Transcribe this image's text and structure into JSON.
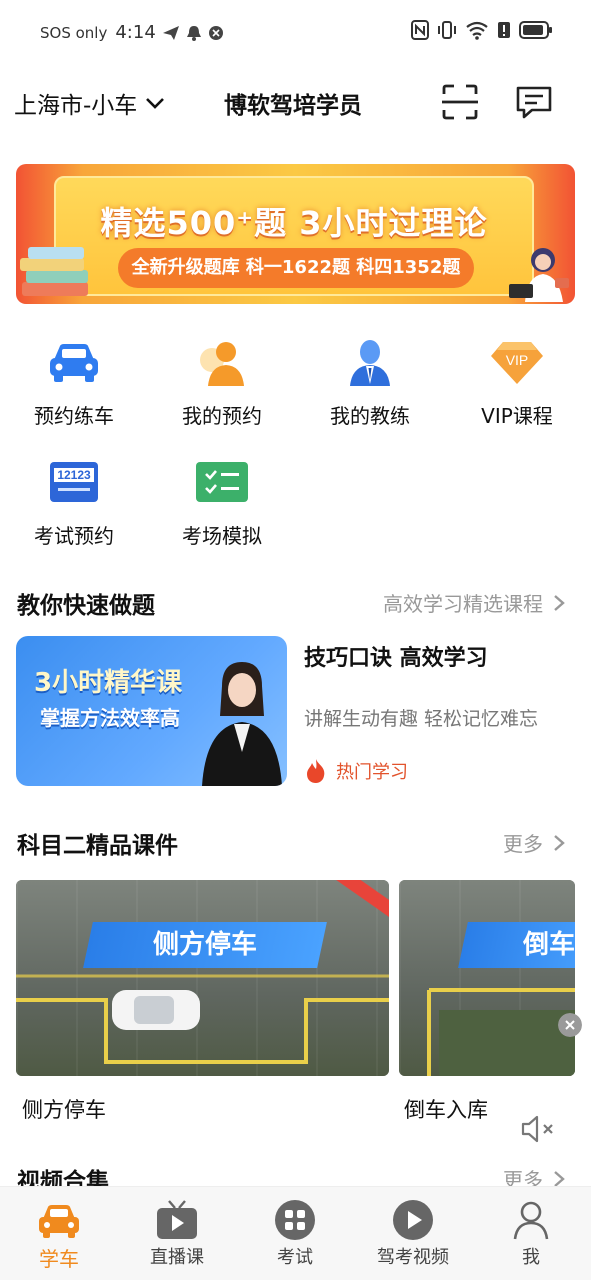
{
  "status_bar": {
    "carrier": "SOS only",
    "time": "4:14"
  },
  "header": {
    "city": "上海市-小车",
    "title": "博软驾培学员"
  },
  "banner": {
    "headline": "精选500⁺题 3小时过理论",
    "subline": "全新升级题库 科一1622题 科四1352题"
  },
  "menu": [
    {
      "label": "预约练车",
      "icon": "car-icon"
    },
    {
      "label": "我的预约",
      "icon": "person-icon"
    },
    {
      "label": "我的教练",
      "icon": "coach-icon"
    },
    {
      "label": "VIP课程",
      "icon": "vip-diamond-icon"
    },
    {
      "label": "考试预约",
      "icon": "12123-icon"
    },
    {
      "label": "考场模拟",
      "icon": "checklist-icon"
    }
  ],
  "section_quick": {
    "title": "教你快速做题",
    "more": "高效学习精选课程",
    "card": {
      "thumb_line1": "3小时精华课",
      "thumb_line2": "掌握方法效率高",
      "title": "技巧口诀 高效学习",
      "desc": "讲解生动有趣 轻松记忆难忘",
      "tag": "热门学习"
    }
  },
  "section_subject2": {
    "title": "科目二精品课件",
    "more": "更多",
    "videos": [
      {
        "ribbon": "侧方停车",
        "label": "侧方停车"
      },
      {
        "ribbon": "倒车",
        "label": "倒车入库"
      }
    ]
  },
  "section_video": {
    "title": "视频合集",
    "more": "更多"
  },
  "tabbar": [
    {
      "label": "学车",
      "active": true
    },
    {
      "label": "直播课"
    },
    {
      "label": "考试"
    },
    {
      "label": "驾考视频"
    },
    {
      "label": "我"
    }
  ],
  "colors": {
    "accent": "#f08a1e",
    "blue": "#2f7cf0",
    "hot": "#e2532c"
  }
}
